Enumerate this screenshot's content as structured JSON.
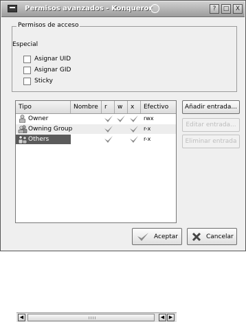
{
  "window": {
    "title": "Permisos avanzados - Konqueror",
    "help_button": "?",
    "minimize_button": "□",
    "close_button": "X"
  },
  "access_group": {
    "title": "Permisos de acceso",
    "special_label": "Especial",
    "checkboxes": [
      {
        "label": "Asignar UID",
        "checked": false
      },
      {
        "label": "Asignar GID",
        "checked": false
      },
      {
        "label": "Sticky",
        "checked": false
      }
    ]
  },
  "table": {
    "columns": [
      "Tipo",
      "Nombre",
      "r",
      "w",
      "x",
      "Efectivo"
    ],
    "rows": [
      {
        "tipo": "Owner",
        "nombre": "",
        "r": true,
        "w": true,
        "x": true,
        "efectivo": "rwx"
      },
      {
        "tipo": "Owning Group",
        "nombre": "",
        "r": true,
        "w": false,
        "x": true,
        "efectivo": "r-x"
      },
      {
        "tipo": "Others",
        "nombre": "",
        "r": true,
        "w": false,
        "x": true,
        "efectivo": "r-x",
        "selected": true
      }
    ]
  },
  "side_buttons": {
    "add": "Añadir entrada...",
    "edit": "Editar entrada...",
    "delete": "Eliminar entrada"
  },
  "bottom_buttons": {
    "ok": "Aceptar",
    "cancel": "Cancelar"
  },
  "colors": {
    "titlebar": "#9c9c9c",
    "selection": "#5b5b5b",
    "check": "#8a8a8a",
    "window_bg": "#efefef"
  }
}
